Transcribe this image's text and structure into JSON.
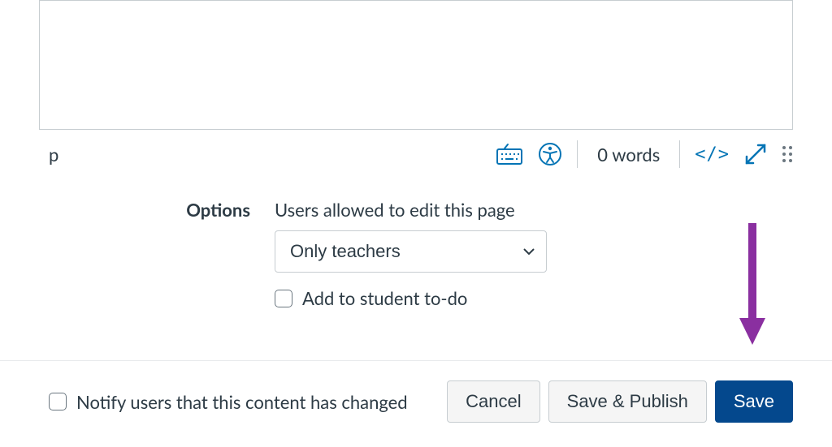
{
  "editor": {
    "element_path": "p",
    "word_count_text": "0 words",
    "html_toggle_label": "</>"
  },
  "options": {
    "section_label": "Options",
    "allowed_label": "Users allowed to edit this page",
    "allowed_selected": "Only teachers",
    "todo_label": "Add to student to-do"
  },
  "footer": {
    "notify_label": "Notify users that this content has changed",
    "cancel_label": "Cancel",
    "save_publish_label": "Save & Publish",
    "save_label": "Save"
  }
}
